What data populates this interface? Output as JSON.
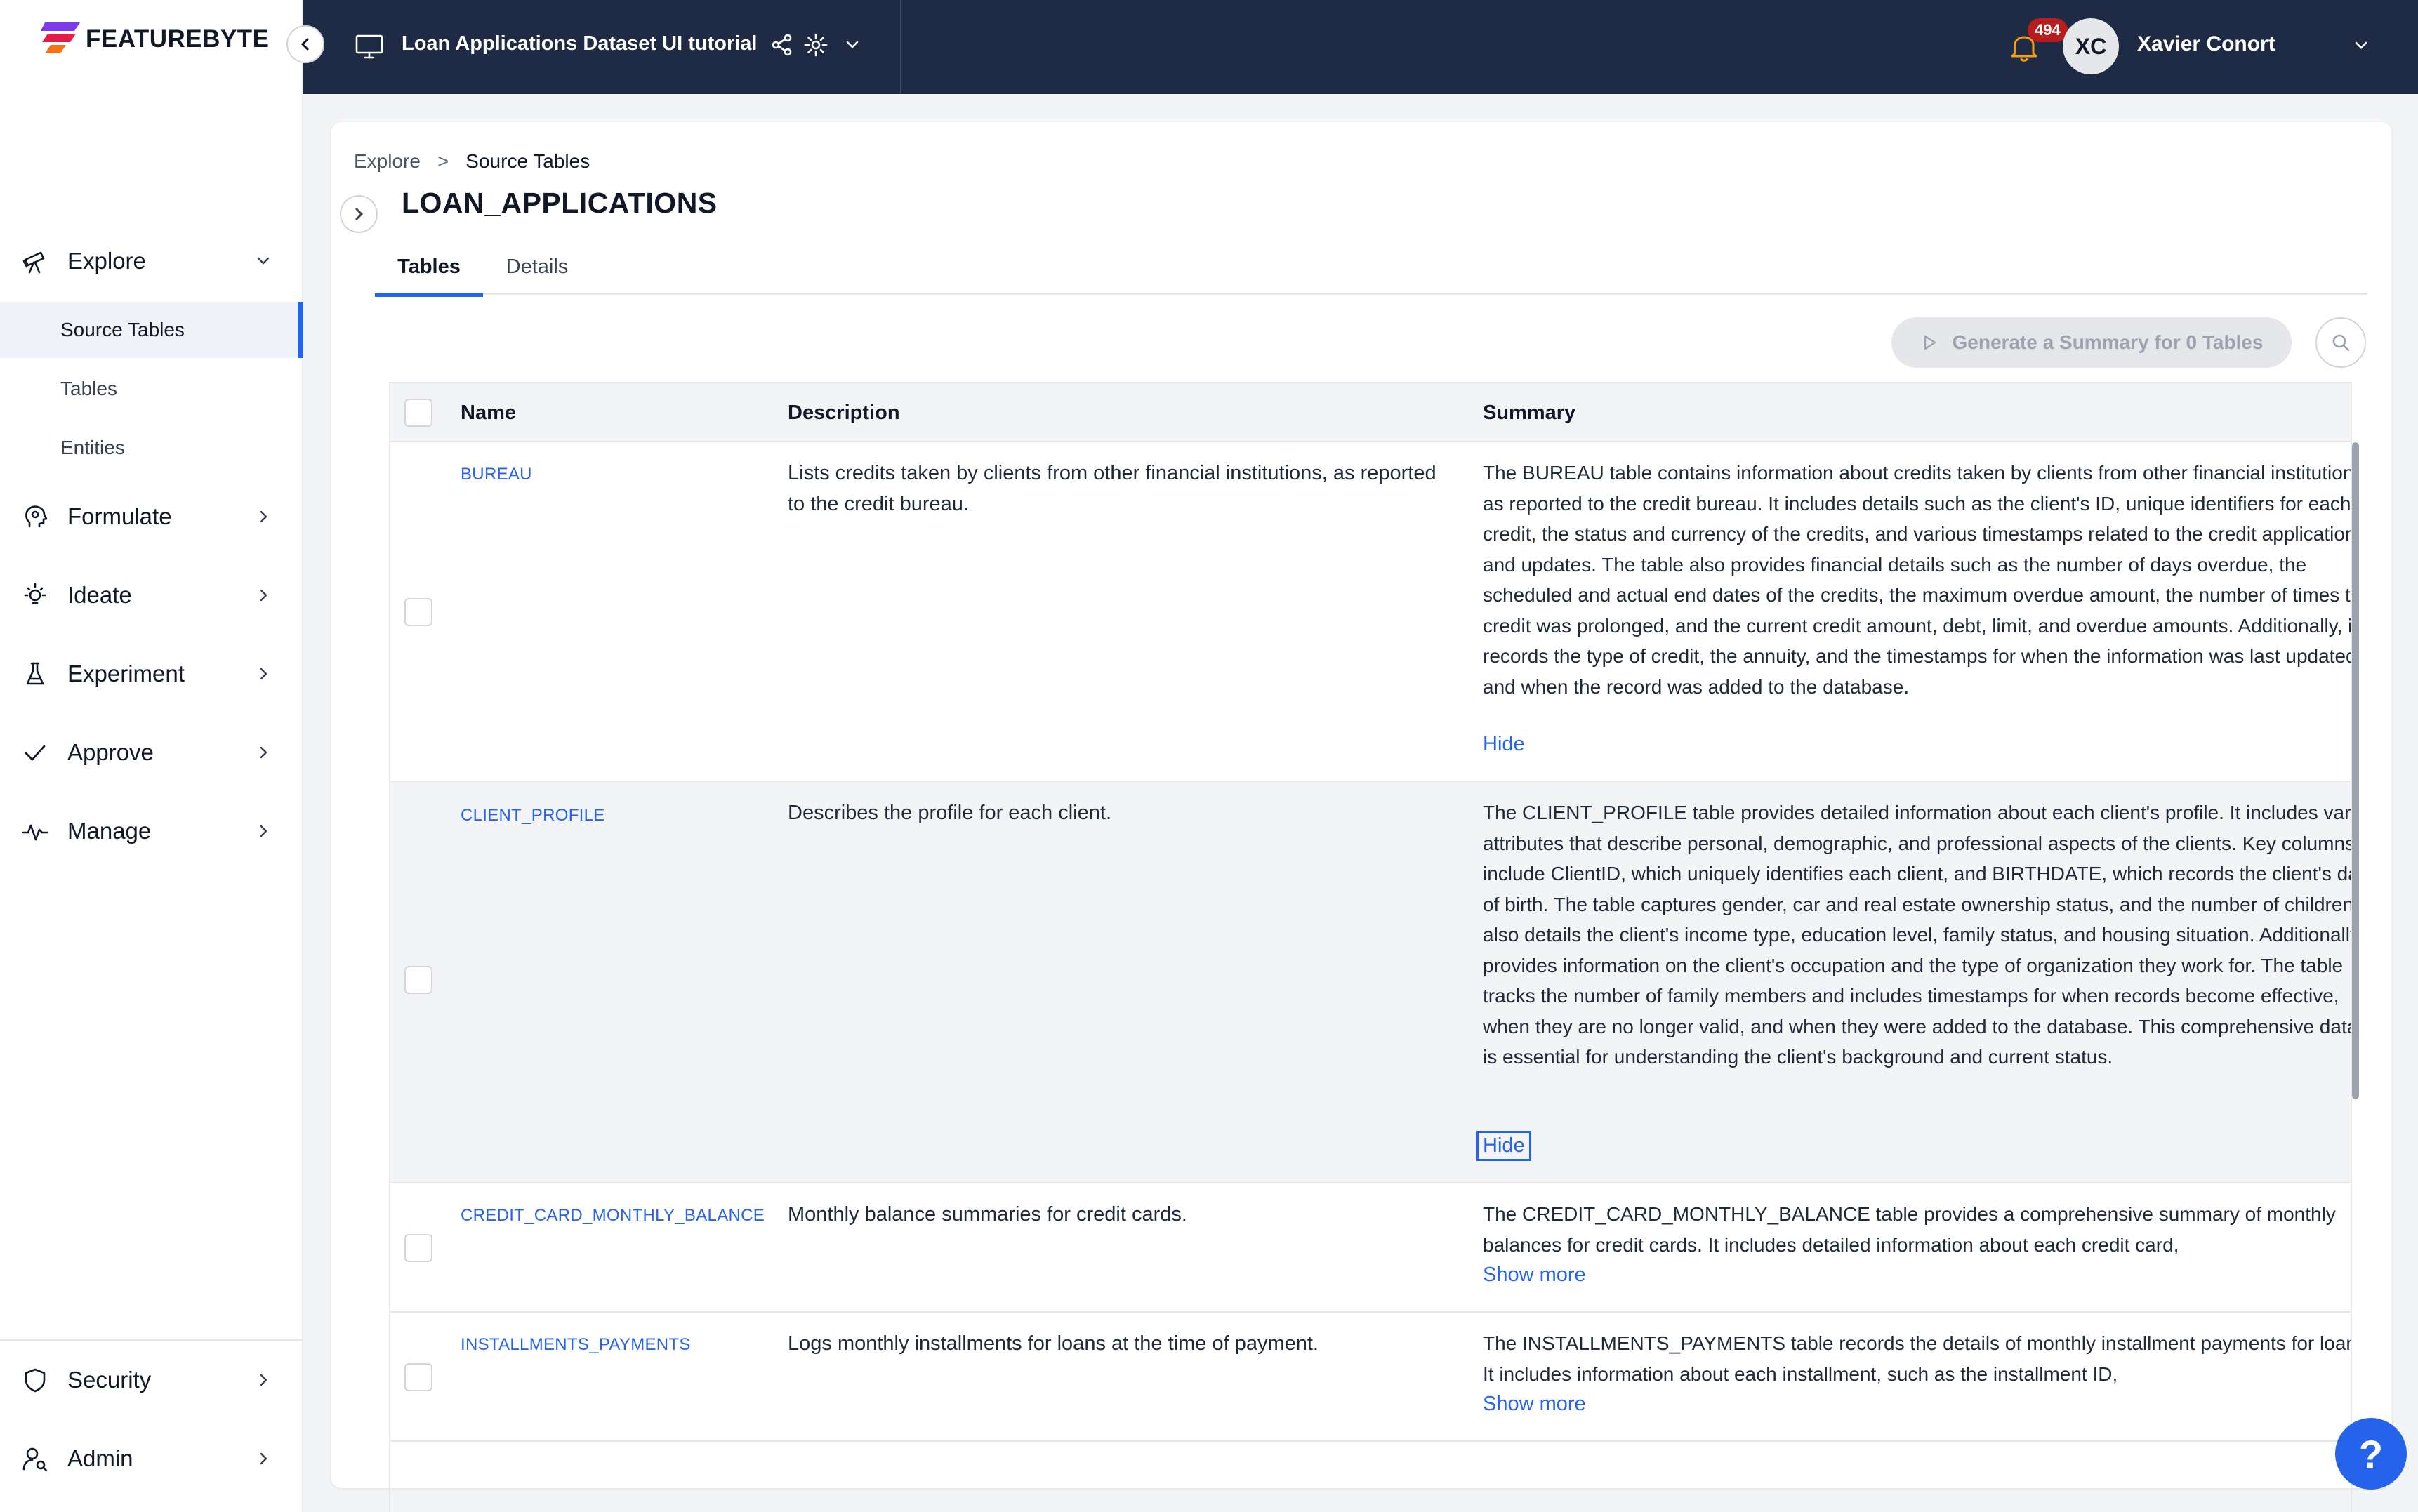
{
  "brand": {
    "name": "FEATUREBYTE"
  },
  "topbar": {
    "project_title": "Loan Applications Dataset UI tutorial",
    "notifications_count": "494",
    "user_initials": "XC",
    "user_name": "Xavier Conort"
  },
  "sidebar": {
    "explore": "Explore",
    "explore_items": [
      "Source Tables",
      "Tables",
      "Entities"
    ],
    "formulate": "Formulate",
    "ideate": "Ideate",
    "experiment": "Experiment",
    "approve": "Approve",
    "manage": "Manage",
    "security": "Security",
    "admin": "Admin"
  },
  "breadcrumb": {
    "root": "Explore",
    "separator": ">",
    "current": "Source Tables"
  },
  "page": {
    "title": "LOAN_APPLICATIONS"
  },
  "tabs": [
    "Tables",
    "Details"
  ],
  "toolbar": {
    "generate_label": "Generate a Summary for 0 Tables"
  },
  "table": {
    "columns": [
      "Name",
      "Description",
      "Summary"
    ],
    "rows": [
      {
        "name": "BUREAU",
        "description": "Lists credits taken by clients from other financial institutions, as reported to the credit bureau.",
        "summary": "The BUREAU table contains information about credits taken by clients from other financial institutions, as reported to the credit bureau. It includes details such as the client's ID, unique identifiers for each credit, the status and currency of the credits, and various timestamps related to the credit application and updates. The table also provides financial details such as the number of days overdue, the scheduled and actual end dates of the credits, the maximum overdue amount, the number of times the credit was prolonged, and the current credit amount, debt, limit, and overdue amounts. Additionally, it records the type of credit, the annuity, and the timestamps for when the information was last updated and when the record was added to the database.",
        "action": "Hide"
      },
      {
        "name": "CLIENT_PROFILE",
        "description": "Describes the profile for each client.",
        "summary": "The CLIENT_PROFILE table provides detailed information about each client's profile. It includes various attributes that describe personal, demographic, and professional aspects of the clients. Key columns include ClientID, which uniquely identifies each client, and BIRTHDATE, which records the client's date of birth. The table captures gender, car and real estate ownership status, and the number of children. It also details the client's income type, education level, family status, and housing situation. Additionally, it provides information on the client's occupation and the type of organization they work for. The table tracks the number of family members and includes timestamps for when records become effective, when they are no longer valid, and when they were added to the database. This comprehensive dataset is essential for understanding the client's background and current status.",
        "action": "Hide"
      },
      {
        "name": "CREDIT_CARD_MONTHLY_BALANCE",
        "description": "Monthly balance summaries for credit cards.",
        "summary": "The CREDIT_CARD_MONTHLY_BALANCE table provides a comprehensive summary of monthly balances for credit cards. It includes detailed information about each credit card,",
        "action": "Show more"
      },
      {
        "name": "INSTALLMENTS_PAYMENTS",
        "description": "Logs monthly installments for loans at the time of payment.",
        "summary": "The INSTALLMENTS_PAYMENTS table records the details of monthly installment payments for loans. It includes information about each installment, such as the installment ID,",
        "action": "Show more"
      }
    ]
  },
  "help": {
    "label": "?"
  }
}
